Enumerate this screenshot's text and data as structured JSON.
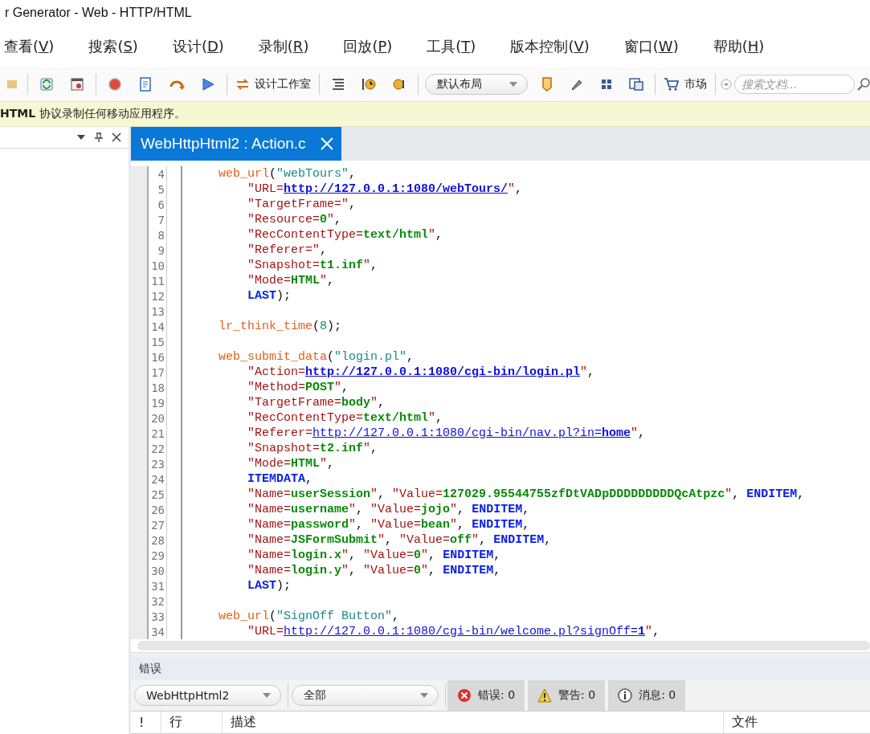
{
  "window": {
    "title": "r Generator - Web - HTTP/HTML"
  },
  "menu": [
    {
      "label": "查看(V)",
      "mnemonic": true
    },
    {
      "label": "搜索(S)",
      "mnemonic": true
    },
    {
      "label": "设计(D)",
      "mnemonic": true
    },
    {
      "label": "录制(R)",
      "mnemonic": true
    },
    {
      "label": "回放(P)",
      "mnemonic": true
    },
    {
      "label": "工具(T)",
      "mnemonic": true
    },
    {
      "label": "版本控制(V)",
      "mnemonic": true
    },
    {
      "label": "窗口(W)",
      "mnemonic": true
    },
    {
      "label": "帮助(H)",
      "mnemonic": true
    }
  ],
  "toolbar": {
    "design_button": {
      "label": "设计工作室"
    },
    "layout_dropdown": {
      "value": "默认布局"
    },
    "market_button": {
      "label": "市场"
    },
    "search": {
      "placeholder": "搜索文档..."
    }
  },
  "info_bar": {
    "text": "**HTML** 协议录制任何移动应用程序。"
  },
  "editor": {
    "tabs": [
      {
        "label": "WebHttpHtml2 : Action.c",
        "selected": true
      }
    ],
    "lines": [
      {
        "number": "4",
        "tokens": [
          {
            "kind": "fn",
            "text": "web_url"
          },
          {
            "kind": "p",
            "text": "("
          },
          {
            "kind": "s",
            "text": "\"webTours\""
          },
          {
            "kind": "p",
            "text": ","
          }
        ],
        "children": [
          {
            "number": "5",
            "tokens": [
              {
                "kind": "a",
                "text": "\"URL="
              },
              {
                "kind": "L",
                "text": "http://127.0.0.1:1080/webTours/"
              },
              {
                "kind": "a",
                "text": "\""
              },
              {
                "kind": "p",
                "text": ","
              }
            ]
          },
          {
            "number": "6",
            "tokens": [
              {
                "kind": "a",
                "text": "\"TargetFrame=\""
              },
              {
                "kind": "p",
                "text": ","
              }
            ]
          },
          {
            "number": "7",
            "tokens": [
              {
                "kind": "a",
                "text": "\"Resource="
              },
              {
                "kind": "v",
                "text": "0"
              },
              {
                "kind": "a",
                "text": "\""
              },
              {
                "kind": "p",
                "text": ","
              }
            ]
          },
          {
            "number": "8",
            "tokens": [
              {
                "kind": "a",
                "text": "\"RecContentType="
              },
              {
                "kind": "v",
                "text": "text/html"
              },
              {
                "kind": "a",
                "text": "\""
              },
              {
                "kind": "p",
                "text": ","
              }
            ]
          },
          {
            "number": "9",
            "tokens": [
              {
                "kind": "a",
                "text": "\"Referer=\""
              },
              {
                "kind": "p",
                "text": ","
              }
            ]
          },
          {
            "number": "10",
            "tokens": [
              {
                "kind": "a",
                "text": "\"Snapshot="
              },
              {
                "kind": "v",
                "text": "t1.inf"
              },
              {
                "kind": "a",
                "text": "\""
              },
              {
                "kind": "p",
                "text": ","
              }
            ]
          },
          {
            "number": "11",
            "tokens": [
              {
                "kind": "a",
                "text": "\"Mode="
              },
              {
                "kind": "v",
                "text": "HTML"
              },
              {
                "kind": "a",
                "text": "\""
              },
              {
                "kind": "p",
                "text": ","
              }
            ]
          },
          {
            "number": "12",
            "tokens": [
              {
                "kind": "k",
                "text": "LAST"
              },
              {
                "kind": "p",
                "text": ");"
              }
            ]
          }
        ]
      },
      {
        "number": "13"
      },
      {
        "number": "14",
        "tokens": [
          {
            "kind": "fn",
            "text": "lr_think_time"
          },
          {
            "kind": "p",
            "text": "("
          },
          {
            "kind": "n",
            "text": "8"
          },
          {
            "kind": "p",
            "text": ");"
          }
        ]
      },
      {
        "number": "15"
      },
      {
        "number": "16",
        "tokens": [
          {
            "kind": "fn",
            "text": "web_submit_data"
          },
          {
            "kind": "p",
            "text": "("
          },
          {
            "kind": "s",
            "text": "\"login.pl\""
          },
          {
            "kind": "p",
            "text": ","
          }
        ],
        "children": [
          {
            "number": "17",
            "tokens": [
              {
                "kind": "a",
                "text": "\"Action="
              },
              {
                "kind": "L",
                "text": "http://127.0.0.1:1080/cgi-bin/login.pl"
              },
              {
                "kind": "a",
                "text": "\""
              },
              {
                "kind": "p",
                "text": ","
              }
            ]
          },
          {
            "number": "18",
            "tokens": [
              {
                "kind": "a",
                "text": "\"Method="
              },
              {
                "kind": "v",
                "text": "POST"
              },
              {
                "kind": "a",
                "text": "\""
              },
              {
                "kind": "p",
                "text": ","
              }
            ]
          },
          {
            "number": "19",
            "tokens": [
              {
                "kind": "a",
                "text": "\"TargetFrame="
              },
              {
                "kind": "v",
                "text": "body"
              },
              {
                "kind": "a",
                "text": "\""
              },
              {
                "kind": "p",
                "text": ","
              }
            ]
          },
          {
            "number": "20",
            "tokens": [
              {
                "kind": "a",
                "text": "\"RecContentType="
              },
              {
                "kind": "v",
                "text": "text/html"
              },
              {
                "kind": "a",
                "text": "\""
              },
              {
                "kind": "p",
                "text": ","
              }
            ]
          },
          {
            "number": "21",
            "tokens": [
              {
                "kind": "a",
                "text": "\"Referer="
              },
              {
                "kind": "l",
                "text": "http://127.0.0.1:1080/cgi-bin/nav.pl?in=**home**"
              },
              {
                "kind": "a",
                "text": "\""
              },
              {
                "kind": "p",
                "text": ","
              }
            ]
          },
          {
            "number": "22",
            "tokens": [
              {
                "kind": "a",
                "text": "\"Snapshot="
              },
              {
                "kind": "v",
                "text": "t2.inf"
              },
              {
                "kind": "a",
                "text": "\""
              },
              {
                "kind": "p",
                "text": ","
              }
            ]
          },
          {
            "number": "23",
            "tokens": [
              {
                "kind": "a",
                "text": "\"Mode="
              },
              {
                "kind": "v",
                "text": "HTML"
              },
              {
                "kind": "a",
                "text": "\""
              },
              {
                "kind": "p",
                "text": ","
              }
            ]
          },
          {
            "number": "24",
            "tokens": [
              {
                "kind": "k",
                "text": "ITEMDATA"
              },
              {
                "kind": "p",
                "text": ","
              }
            ]
          },
          {
            "number": "25",
            "tokens": [
              {
                "kind": "a",
                "text": "\"Name="
              },
              {
                "kind": "v",
                "text": "userSession"
              },
              {
                "kind": "a",
                "text": "\""
              },
              {
                "kind": "p",
                "text": ", "
              },
              {
                "kind": "a",
                "text": "\"Value="
              },
              {
                "kind": "v",
                "text": "127029.95544755zfDtVADpDDDDDDDDDQcAtpzc"
              },
              {
                "kind": "a",
                "text": "\""
              },
              {
                "kind": "p",
                "text": ", "
              },
              {
                "kind": "k",
                "text": "ENDITEM"
              },
              {
                "kind": "p",
                "text": ","
              }
            ]
          },
          {
            "number": "26",
            "tokens": [
              {
                "kind": "a",
                "text": "\"Name="
              },
              {
                "kind": "v",
                "text": "username"
              },
              {
                "kind": "a",
                "text": "\""
              },
              {
                "kind": "p",
                "text": ", "
              },
              {
                "kind": "a",
                "text": "\"Value="
              },
              {
                "kind": "v",
                "text": "jojo"
              },
              {
                "kind": "a",
                "text": "\""
              },
              {
                "kind": "p",
                "text": ", "
              },
              {
                "kind": "k",
                "text": "ENDITEM"
              },
              {
                "kind": "p",
                "text": ","
              }
            ]
          },
          {
            "number": "27",
            "tokens": [
              {
                "kind": "a",
                "text": "\"Name="
              },
              {
                "kind": "v",
                "text": "password"
              },
              {
                "kind": "a",
                "text": "\""
              },
              {
                "kind": "p",
                "text": ", "
              },
              {
                "kind": "a",
                "text": "\"Value="
              },
              {
                "kind": "v",
                "text": "bean"
              },
              {
                "kind": "a",
                "text": "\""
              },
              {
                "kind": "p",
                "text": ", "
              },
              {
                "kind": "k",
                "text": "ENDITEM"
              },
              {
                "kind": "p",
                "text": ","
              }
            ]
          },
          {
            "number": "28",
            "tokens": [
              {
                "kind": "a",
                "text": "\"Name="
              },
              {
                "kind": "v",
                "text": "JSFormSubmit"
              },
              {
                "kind": "a",
                "text": "\""
              },
              {
                "kind": "p",
                "text": ", "
              },
              {
                "kind": "a",
                "text": "\"Value="
              },
              {
                "kind": "v",
                "text": "off"
              },
              {
                "kind": "a",
                "text": "\""
              },
              {
                "kind": "p",
                "text": ", "
              },
              {
                "kind": "k",
                "text": "ENDITEM"
              },
              {
                "kind": "p",
                "text": ","
              }
            ]
          },
          {
            "number": "29",
            "tokens": [
              {
                "kind": "a",
                "text": "\"Name="
              },
              {
                "kind": "v",
                "text": "login.x"
              },
              {
                "kind": "a",
                "text": "\""
              },
              {
                "kind": "p",
                "text": ", "
              },
              {
                "kind": "a",
                "text": "\"Value="
              },
              {
                "kind": "v",
                "text": "0"
              },
              {
                "kind": "a",
                "text": "\""
              },
              {
                "kind": "p",
                "text": ", "
              },
              {
                "kind": "k",
                "text": "ENDITEM"
              },
              {
                "kind": "p",
                "text": ","
              }
            ]
          },
          {
            "number": "30",
            "tokens": [
              {
                "kind": "a",
                "text": "\"Name="
              },
              {
                "kind": "v",
                "text": "login.y"
              },
              {
                "kind": "a",
                "text": "\""
              },
              {
                "kind": "p",
                "text": ", "
              },
              {
                "kind": "a",
                "text": "\"Value="
              },
              {
                "kind": "v",
                "text": "0"
              },
              {
                "kind": "a",
                "text": "\""
              },
              {
                "kind": "p",
                "text": ", "
              },
              {
                "kind": "k",
                "text": "ENDITEM"
              },
              {
                "kind": "p",
                "text": ","
              }
            ]
          },
          {
            "number": "31",
            "tokens": [
              {
                "kind": "k",
                "text": "LAST"
              },
              {
                "kind": "p",
                "text": ");"
              }
            ]
          }
        ]
      },
      {
        "number": "32"
      },
      {
        "number": "33",
        "tokens": [
          {
            "kind": "fn",
            "text": "web_url"
          },
          {
            "kind": "p",
            "text": "("
          },
          {
            "kind": "s",
            "text": "\"SignOff Button\""
          },
          {
            "kind": "p",
            "text": ","
          }
        ],
        "children": [
          {
            "number": "34",
            "tokens": [
              {
                "kind": "a",
                "text": "\"URL="
              },
              {
                "kind": "l",
                "text": "http://127.0.0.1:1080/cgi-bin/welcome.pl?signOff=**1**"
              },
              {
                "kind": "a",
                "text": "\""
              },
              {
                "kind": "p",
                "text": ","
              }
            ]
          }
        ]
      }
    ]
  },
  "errors_panel": {
    "title": "错误",
    "project_dropdown": {
      "value": "WebHttpHtml2"
    },
    "filter_dropdown": {
      "value": "全部"
    },
    "counters": [
      {
        "kind": "error",
        "label": "错误: 0"
      },
      {
        "kind": "warning",
        "label": "警告: 0"
      },
      {
        "kind": "info",
        "label": "消息: 0"
      }
    ],
    "columns": [
      "!",
      "行",
      "描述",
      "文件"
    ]
  }
}
